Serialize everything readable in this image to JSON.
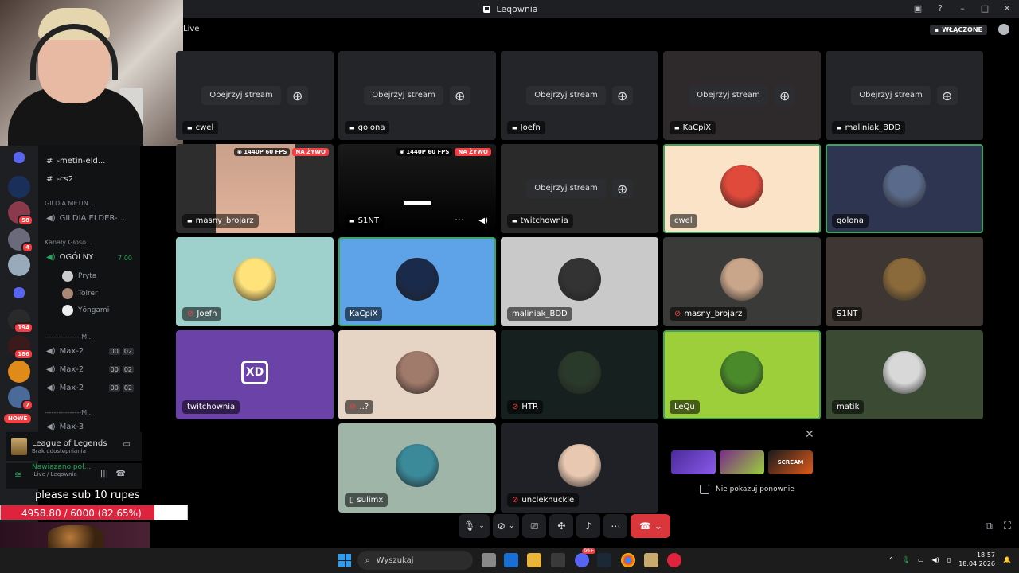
{
  "window": {
    "title": "Leqownia",
    "live_label": "Live",
    "enabled_badge": "WŁĄCZONE"
  },
  "rail": {
    "badges": [
      "58",
      "4",
      "194",
      "186",
      "7"
    ],
    "new_label": "NOWE"
  },
  "channels": {
    "text": [
      {
        "label": "-metin-eld..."
      },
      {
        "label": "-cs2"
      }
    ],
    "category1": "GILDIA METIN...",
    "guild_channel": "GILDIA ELDER-...",
    "category2": "Kanały Głoso...",
    "voice_main": {
      "label": "OGÓLNY",
      "timer": "7:00"
    },
    "voice_users": [
      "Pryta",
      "Tolrer",
      "Yōngami"
    ],
    "separator": "----------------M...",
    "max_channels": [
      {
        "label": "Max-2",
        "a": "00",
        "b": "02"
      },
      {
        "label": "Max-2",
        "a": "00",
        "b": "02"
      },
      {
        "label": "Max-2",
        "a": "00",
        "b": "02"
      }
    ],
    "separator2": "----------------M...",
    "max3": "Max-3"
  },
  "activity": {
    "game": "League of Legends",
    "game_sub": "Brak udostępniania",
    "voice_status": "Nawiązano poł...",
    "voice_sub": "-Live / Leqownia"
  },
  "overlay": {
    "sub_text": "please sub 10 rupes",
    "progress_text": "4958.80 / 6000 (82.65%)",
    "progress_fraction": 0.8265
  },
  "watch_label": "Obejrzyj stream",
  "stream_badges": {
    "quality": "1440P 60 FPS",
    "live": "NA ŻYWO"
  },
  "tiles": [
    {
      "name": "cwel",
      "kind": "watch"
    },
    {
      "name": "golona",
      "kind": "watch"
    },
    {
      "name": "Joefn",
      "kind": "watch"
    },
    {
      "name": "KaCpiX",
      "kind": "watch"
    },
    {
      "name": "maliniak_BDD",
      "kind": "watch"
    },
    {
      "name": "masny_brojarz",
      "kind": "stream"
    },
    {
      "name": "S1NT",
      "kind": "stream"
    },
    {
      "name": "twitchownia",
      "kind": "watch"
    },
    {
      "name": "cwel",
      "kind": "avatar"
    },
    {
      "name": "golona",
      "kind": "avatar"
    },
    {
      "name": "Joefn",
      "kind": "avatar"
    },
    {
      "name": "KaCpiX",
      "kind": "avatar"
    },
    {
      "name": "maliniak_BDD",
      "kind": "avatar"
    },
    {
      "name": "masny_brojarz",
      "kind": "avatar"
    },
    {
      "name": "S1NT",
      "kind": "avatar"
    },
    {
      "name": "twitchownia",
      "kind": "avatar"
    },
    {
      "name": "..?",
      "kind": "avatar"
    },
    {
      "name": "HTR",
      "kind": "avatar"
    },
    {
      "name": "LeQu",
      "kind": "avatar"
    },
    {
      "name": "matik",
      "kind": "avatar"
    },
    {
      "name": "sulimx",
      "kind": "avatar"
    },
    {
      "name": "uncleknuckle",
      "kind": "avatar"
    }
  ],
  "tile_avatar_text": "XD",
  "promo": {
    "checkbox_label": "Nie pokazuj ponownie",
    "thumb3": "SCREAM"
  },
  "taskbar": {
    "search_placeholder": "Wyszukaj",
    "time": "18:57",
    "date": "18.04.2026",
    "notif_count": "99+"
  },
  "colors": {
    "discord_dark": "#1e1f22",
    "speaking_ring": "#3ba55d",
    "live_red": "#f23f43"
  }
}
